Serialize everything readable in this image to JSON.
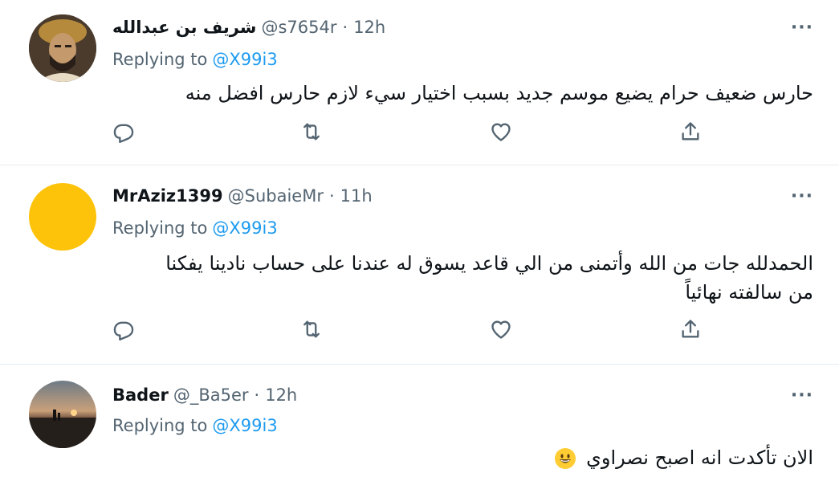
{
  "replies": [
    {
      "display_name": "شريف بن عبدالله",
      "handle": "@s7654r",
      "separator": "·",
      "time": "12h",
      "more": "···",
      "replying_label": "Replying to",
      "replying_to": "@X99i3",
      "text": "حارس ضعيف حرام يضيع موسم جديد بسبب اختيار سيء لازم حارس افضل منه",
      "avatar_icon": "person-photo-avatar"
    },
    {
      "display_name": "MrAziz1399",
      "handle": "@SubaieMr",
      "separator": "·",
      "time": "11h",
      "more": "···",
      "replying_label": "Replying to",
      "replying_to": "@X99i3",
      "text_line1": "الحمدلله جات من الله وأتمنى من الي قاعد يسوق له عندنا على حساب نادينا يفكنا",
      "text_line2": "من سالفته نهائياً",
      "avatar_color": "#fdc30a"
    },
    {
      "display_name": "Bader",
      "handle": "@_Ba5er",
      "separator": "·",
      "time": "12h",
      "more": "···",
      "replying_label": "Replying to",
      "replying_to": "@X99i3",
      "text": "الان تأكدت انه اصبح نصراوي",
      "emoji_icon": "grinning-face-emoji",
      "avatar_icon": "sunset-landscape-avatar"
    }
  ],
  "colors": {
    "accent": "#1d9bf0",
    "secondary_text": "#536471",
    "divider": "#e6ecf0"
  }
}
